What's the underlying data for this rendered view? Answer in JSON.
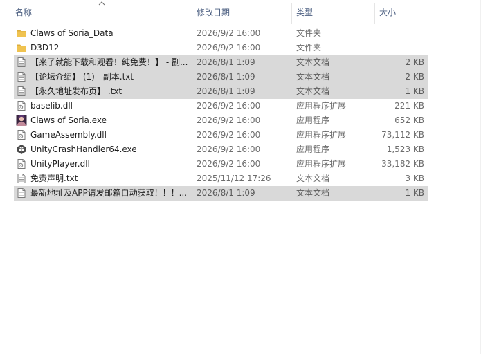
{
  "columns": {
    "name": "名称",
    "date": "修改日期",
    "type": "类型",
    "size": "大小"
  },
  "sort": {
    "column": "name",
    "direction": "ascending"
  },
  "colors": {
    "selected_row": "#d9d9d9",
    "header_text": "#4d6082",
    "folder": "#f0c350"
  },
  "files": [
    {
      "name": "Claws of Soria_Data",
      "date": "2026/9/2 16:00",
      "type": "文件夹",
      "size": "",
      "icon": "folder-icon",
      "selected": false
    },
    {
      "name": "D3D12",
      "date": "2026/9/2 16:00",
      "type": "文件夹",
      "size": "",
      "icon": "folder-icon",
      "selected": false
    },
    {
      "name": "【来了就能下载和观看！纯免费！】 - 副...",
      "date": "2026/8/1 1:09",
      "type": "文本文档",
      "size": "2 KB",
      "icon": "text-file-icon",
      "selected": true
    },
    {
      "name": "【论坛介绍】 (1) - 副本.txt",
      "date": "2026/8/1 1:09",
      "type": "文本文档",
      "size": "2 KB",
      "icon": "text-file-icon",
      "selected": true
    },
    {
      "name": "【永久地址发布页】 .txt",
      "date": "2026/8/1 1:09",
      "type": "文本文档",
      "size": "1 KB",
      "icon": "text-file-icon",
      "selected": true
    },
    {
      "name": "baselib.dll",
      "date": "2026/9/2 16:00",
      "type": "应用程序扩展",
      "size": "221 KB",
      "icon": "dll-file-icon",
      "selected": false
    },
    {
      "name": "Claws of Soria.exe",
      "date": "2026/9/2 16:00",
      "type": "应用程序",
      "size": "652 KB",
      "icon": "game-app-icon",
      "selected": false
    },
    {
      "name": "GameAssembly.dll",
      "date": "2026/9/2 16:00",
      "type": "应用程序扩展",
      "size": "73,112 KB",
      "icon": "dll-file-icon",
      "selected": false
    },
    {
      "name": "UnityCrashHandler64.exe",
      "date": "2026/9/2 16:00",
      "type": "应用程序",
      "size": "1,523 KB",
      "icon": "unity-app-icon",
      "selected": false
    },
    {
      "name": "UnityPlayer.dll",
      "date": "2026/9/2 16:00",
      "type": "应用程序扩展",
      "size": "33,182 KB",
      "icon": "dll-file-icon",
      "selected": false
    },
    {
      "name": "免责声明.txt",
      "date": "2025/11/12 17:26",
      "type": "文本文档",
      "size": "3 KB",
      "icon": "text-file-icon",
      "selected": false
    },
    {
      "name": "最新地址及APP请发邮箱自动获取！！！...",
      "date": "2026/8/1 1:09",
      "type": "文本文档",
      "size": "1 KB",
      "icon": "text-file-icon",
      "selected": true
    }
  ]
}
